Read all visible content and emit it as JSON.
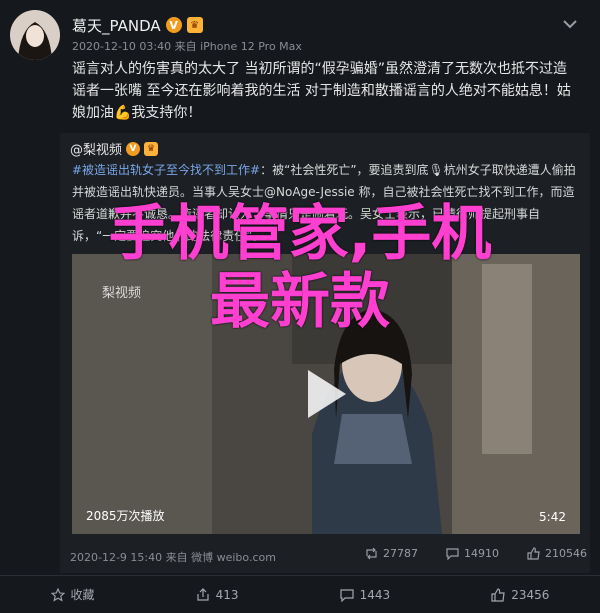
{
  "post": {
    "author": "葛天_PANDA",
    "meta": "2020-12-10 03:40 来自 iPhone 12 Pro Max",
    "content": "谣言对人的伤害真的太大了 当初所谓的“假孕骗婚”虽然澄清了无数次也抵不过造谣者一张嘴 至今还在影响着我的生活 对于制造和散播谣言的人绝对不能姑息！姑娘加油💪我支持你！"
  },
  "quoted": {
    "author": "@梨视频",
    "tag": "#被造谣出轨女子至今找不到工作#",
    "text": "：被“社会性死亡”，要追责到底🎙杭州女子取快递遭人偷拍并被造谣出轨快递员。当事人吴女士@NoAge-Jessie 称，自己被社会性死亡找不到工作，而造谣者道歉并不诚恳。造谣者却认为，事情只是闹着玩。吴女士表示，已请律师提起刑事自诉，“一定要追究他们的法律责任”。",
    "video": {
      "play_count": "2085万次播放",
      "duration": "5:42",
      "watermark": "梨视频"
    },
    "meta": "2020-12-9 15:40 来自 微博 weibo.com",
    "actions": {
      "reposts": "27787",
      "comments": "14910",
      "likes": "210546"
    }
  },
  "footer": {
    "repost_label": "收藏",
    "share_count": "413",
    "comment_count": "1443",
    "like_count": "23456"
  },
  "overlay": {
    "line1": "手机管家,手机",
    "line2": "最新款"
  },
  "colors": {
    "overlay": "#ff3fd0",
    "badge": "#f29c1f",
    "link": "#7aa7e8"
  }
}
